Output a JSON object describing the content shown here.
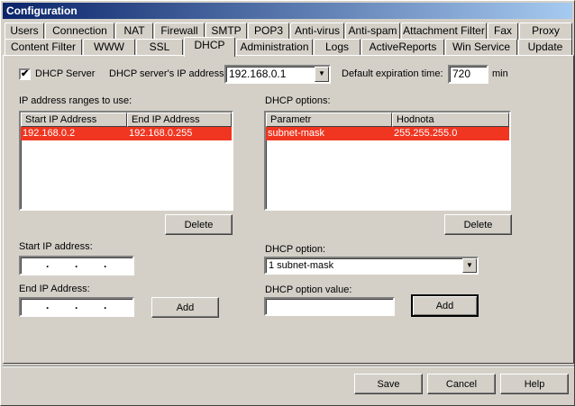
{
  "window": {
    "title": "Configuration"
  },
  "tabs_row1": [
    "Users",
    "Connection",
    "NAT",
    "Firewall",
    "SMTP",
    "POP3",
    "Anti-virus",
    "Anti-spam",
    "Attachment Filter",
    "Fax",
    "Proxy"
  ],
  "tabs_row2": [
    "Content Filter",
    "WWW",
    "SSL",
    "DHCP",
    "Administration",
    "Logs",
    "ActiveReports",
    "Win Service",
    "Update"
  ],
  "active_tab": "DHCP",
  "dhcp": {
    "server_checkbox_label": "DHCP Server",
    "server_checked": true,
    "server_ip_label": "DHCP server's IP address:",
    "server_ip_value": "192.168.0.1",
    "expiration_label": "Default expiration time:",
    "expiration_value": "720",
    "expiration_unit": "min",
    "ranges_label": "IP address ranges to use:",
    "ranges_columns": [
      "Start IP Address",
      "End IP Address"
    ],
    "ranges_rows": [
      [
        "192.168.0.2",
        "192.168.0.255"
      ]
    ],
    "options_label": "DHCP options:",
    "options_columns": [
      "Parametr",
      "Hodnota"
    ],
    "options_rows": [
      [
        "subnet-mask",
        "255.255.255.0"
      ]
    ],
    "delete_label": "Delete",
    "start_ip_label": "Start IP address:",
    "end_ip_label": "End IP Address:",
    "ip_placeholder": ".   .   .",
    "add_label": "Add",
    "option_label": "DHCP option:",
    "option_value": "1 subnet-mask",
    "option_value_label": "DHCP option value:",
    "option_value_input": ""
  },
  "footer": {
    "save": "Save",
    "cancel": "Cancel",
    "help": "Help"
  },
  "colors": {
    "selection": "#f03520",
    "titlebar": "#0a246a"
  }
}
